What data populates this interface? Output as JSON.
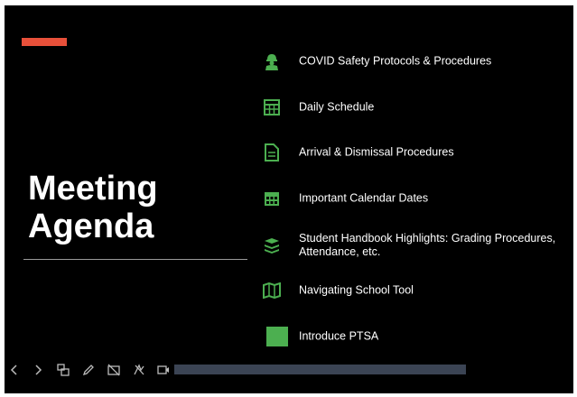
{
  "slide": {
    "title_line1": "Meeting",
    "title_line2": "Agenda",
    "accent_color": "#e8503a",
    "icon_color": "#4caf50",
    "agenda": [
      {
        "icon": "construction-worker-icon",
        "label": "COVID Safety Protocols & Procedures"
      },
      {
        "icon": "schedule-grid-icon",
        "label": "Daily Schedule"
      },
      {
        "icon": "document-icon",
        "label": "Arrival & Dismissal Procedures"
      },
      {
        "icon": "calendar-icon",
        "label": "Important Calendar Dates"
      },
      {
        "icon": "book-stack-icon",
        "label": "Student Handbook Highlights: Grading Procedures, Attendance, etc."
      },
      {
        "icon": "map-icon",
        "label": "Navigating School Tool"
      },
      {
        "icon": "green-square-icon",
        "label": "Introduce PTSA"
      }
    ]
  },
  "toolbar": {
    "buttons": [
      "previous-icon",
      "next-icon",
      "slides-overview-icon",
      "pen-icon",
      "closed-caption-icon",
      "laser-pointer-icon",
      "camera-icon"
    ],
    "progress_fraction": 1.0
  }
}
